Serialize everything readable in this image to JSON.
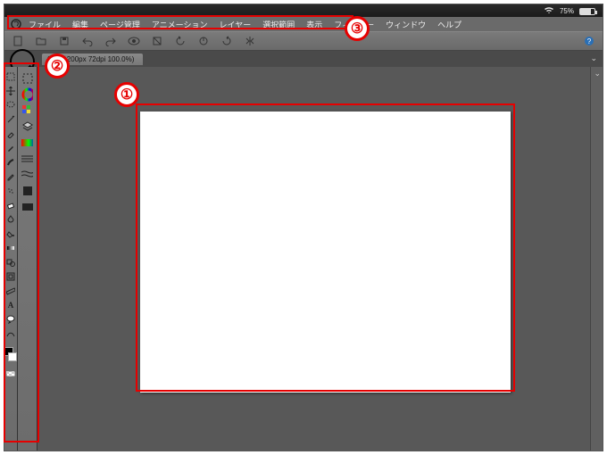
{
  "status": {
    "battery_text": "75%"
  },
  "menubar": {
    "items": [
      "ファイル",
      "編集",
      "ページ管理",
      "アニメーション",
      "レイヤー",
      "選択範囲",
      "表示",
      "フィルター",
      "ウィンドウ",
      "ヘルプ"
    ]
  },
  "tab": {
    "label": "00 x 1200px 72dpi 100.0%)"
  },
  "callouts": {
    "one": "①",
    "two": "②",
    "three": "③"
  },
  "toolbar_icons": [
    "new",
    "open",
    "save",
    "undo",
    "redo",
    "eye",
    "rotate-l",
    "rotate-r",
    "flip-h",
    "grid",
    "snap",
    "move",
    "zoom",
    "help"
  ],
  "palette1": [
    "select",
    "move",
    "lasso",
    "wand",
    "crop",
    "eyedrop",
    "brush",
    "pencil",
    "eraser",
    "fill",
    "gradient",
    "blur",
    "pen",
    "text",
    "shape",
    "hand",
    "note"
  ],
  "palette2": [
    "subtool",
    "color-wheel",
    "swatch",
    "layers",
    "gradient-strip",
    "lines",
    "square",
    "rect",
    "circle"
  ]
}
